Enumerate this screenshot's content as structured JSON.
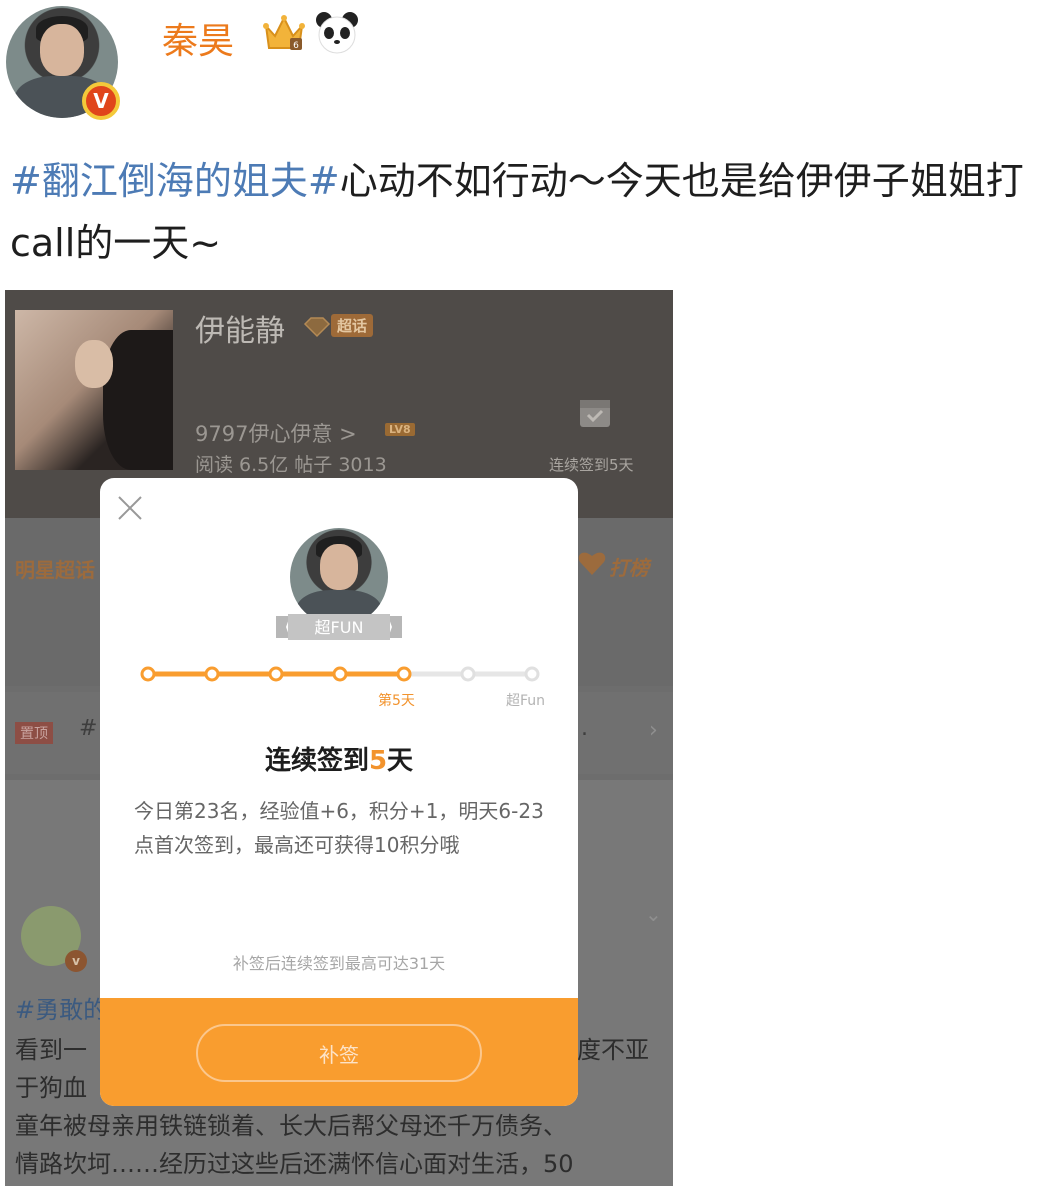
{
  "post": {
    "author_name": "秦昊",
    "verified_badge": "V",
    "icons": [
      "crown-icon",
      "panda-icon"
    ],
    "hashtag": "#翻江倒海的姐夫#",
    "text": "心动不如行动～今天也是给伊伊子姐姐打call的一天~"
  },
  "screenshot": {
    "header": {
      "name": "伊能静",
      "super_tag": "超话",
      "fans": "9797伊心伊意 >",
      "level_badge": "LV8",
      "stats": "阅读 6.5亿    帖子 3013",
      "checkin_label": "连续签到5天"
    },
    "tab_label": "明星超话",
    "rank_label": "打榜",
    "pinned": {
      "tag": "置顶",
      "text": "#",
      "dot": "."
    },
    "feed": {
      "verified_badge": "v",
      "tag": "#勇敢的",
      "line1": "看到一",
      "line1_right": "度不亚",
      "line2": "于狗血",
      "line3": "童年被母亲用铁链锁着、长大后帮父母还千万债务、",
      "line4": "情路坎坷……经历过这些后还满怀信心面对生活，50"
    }
  },
  "modal": {
    "ribbon_label": "超FUN",
    "progress": {
      "current_day": 5,
      "total_nodes": 7,
      "day_label": "第5天",
      "end_label": "超Fun"
    },
    "title_prefix": "连续签到",
    "title_number": "5",
    "title_suffix": "天",
    "description": "今日第23名，经验值+6，积分+1，明天6-23点首次签到，最高还可获得10积分哦",
    "note": "补签后连续签到最高可达31天",
    "button_label": "补签"
  },
  "colors": {
    "accent_orange": "#f99d2f",
    "author_orange": "#ec7a1c",
    "hashtag_blue": "#4d7bb5"
  }
}
